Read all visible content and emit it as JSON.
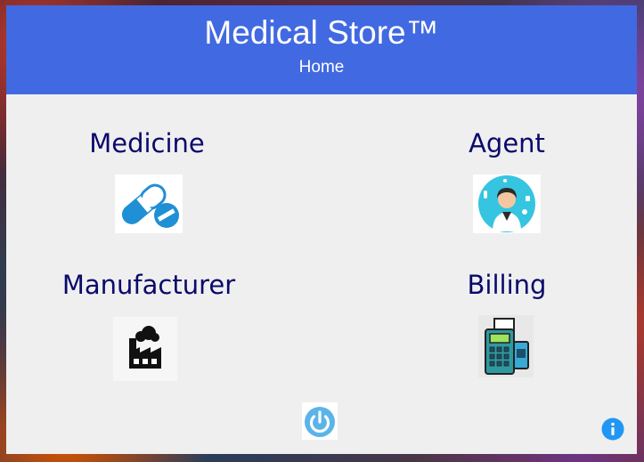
{
  "header": {
    "app_title": "Medical Store™",
    "page_title": "Home"
  },
  "modules": [
    {
      "label": "Medicine",
      "icon": "pill-capsule-icon"
    },
    {
      "label": "Agent",
      "icon": "doctor-avatar-icon"
    },
    {
      "label": "Manufacturer",
      "icon": "factory-icon"
    },
    {
      "label": "Billing",
      "icon": "billing-machine-icon"
    }
  ],
  "footer": {
    "power_icon": "power-icon",
    "info_icon": "info-icon"
  },
  "colors": {
    "header_bg": "#4169e1",
    "panel_bg": "#efeff0",
    "label_color": "#0a0a6b",
    "accent_blue": "#2196f3"
  }
}
